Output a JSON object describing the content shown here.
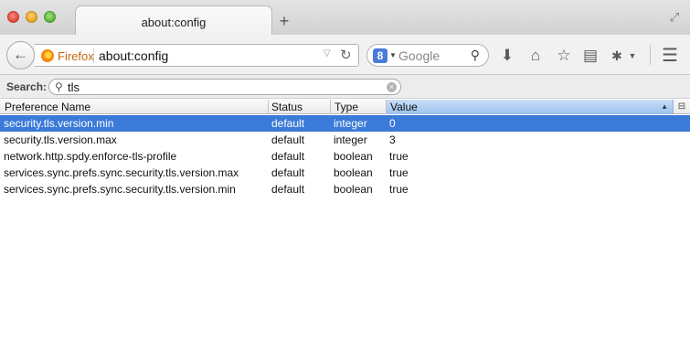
{
  "tab": {
    "title": "about:config",
    "new_tab": "+"
  },
  "navbar": {
    "identity": "Firefox",
    "url": "about:config",
    "search_engine_placeholder": "Google",
    "search_engine_icon": "8"
  },
  "filter": {
    "label": "Search:",
    "value": "tls"
  },
  "columns": {
    "name": "Preference Name",
    "status": "Status",
    "type": "Type",
    "value": "Value"
  },
  "rows": [
    {
      "name": "security.tls.version.min",
      "status": "default",
      "type": "integer",
      "value": "0",
      "selected": true
    },
    {
      "name": "security.tls.version.max",
      "status": "default",
      "type": "integer",
      "value": "3"
    },
    {
      "name": "network.http.spdy.enforce-tls-profile",
      "status": "default",
      "type": "boolean",
      "value": "true"
    },
    {
      "name": "services.sync.prefs.sync.security.tls.version.max",
      "status": "default",
      "type": "boolean",
      "value": "true"
    },
    {
      "name": "services.sync.prefs.sync.security.tls.version.min",
      "status": "default",
      "type": "boolean",
      "value": "true"
    }
  ],
  "colors": {
    "selection": "#3a7ad8",
    "identity": "#c46a0c"
  }
}
